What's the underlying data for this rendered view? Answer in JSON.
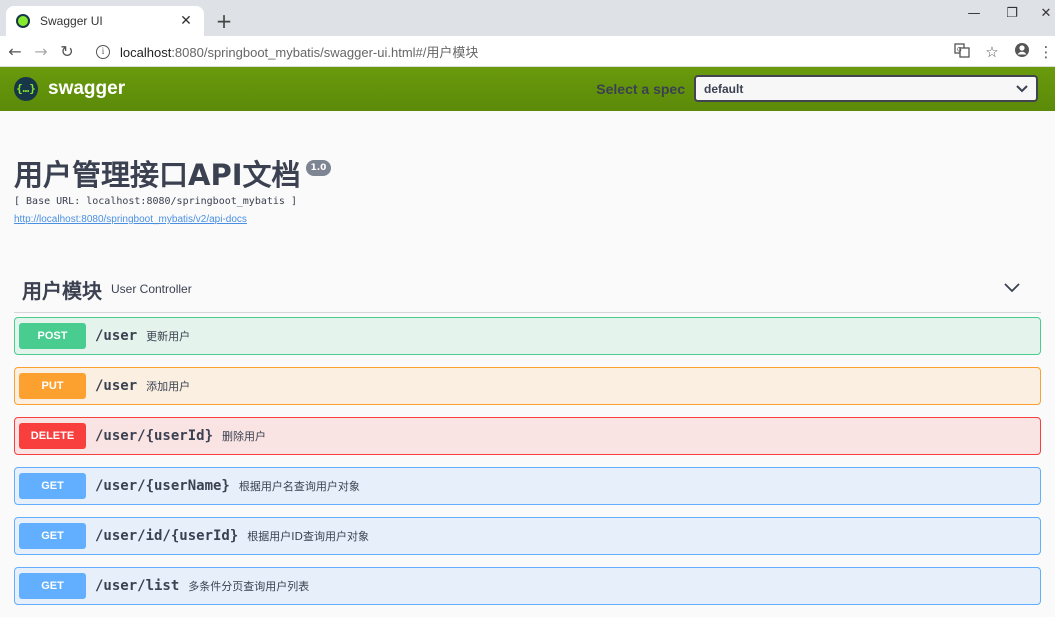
{
  "browser": {
    "tab_title": "Swagger UI",
    "tab_close": "✕",
    "new_tab": "+",
    "url_host": "localhost",
    "url_rest": ":8080/springboot_mybatis/swagger-ui.html#/用户模块",
    "window_controls": [
      "—",
      "❐",
      "✕"
    ],
    "nav": {
      "back": "←",
      "forward": "→",
      "reload": "↻"
    }
  },
  "topbar": {
    "brand": "swagger",
    "logo_glyph": "{…}",
    "spec_label": "Select a spec",
    "spec_value": "default"
  },
  "info": {
    "title": "用户管理接口API文档",
    "version": "1.0",
    "base_url": "[ Base URL: localhost:8080/springboot_mybatis ]",
    "docs_link": "http://localhost:8080/springboot_mybatis/v2/api-docs"
  },
  "tag": {
    "name": "用户模块",
    "description": "User Controller"
  },
  "operations": [
    {
      "method": "POST",
      "path": "/user",
      "summary": "更新用户"
    },
    {
      "method": "PUT",
      "path": "/user",
      "summary": "添加用户"
    },
    {
      "method": "DELETE",
      "path": "/user/{userId}",
      "summary": "删除用户"
    },
    {
      "method": "GET",
      "path": "/user/{userName}",
      "summary": "根据用户名查询用户对象"
    },
    {
      "method": "GET",
      "path": "/user/id/{userId}",
      "summary": "根据用户ID查询用户对象"
    },
    {
      "method": "GET",
      "path": "/user/list",
      "summary": "多条件分页查询用户列表"
    }
  ],
  "colors": {
    "post": "#49cc90",
    "put": "#fca130",
    "delete": "#f93e3e",
    "get": "#61affe",
    "topbar": "#5f8c0a"
  }
}
